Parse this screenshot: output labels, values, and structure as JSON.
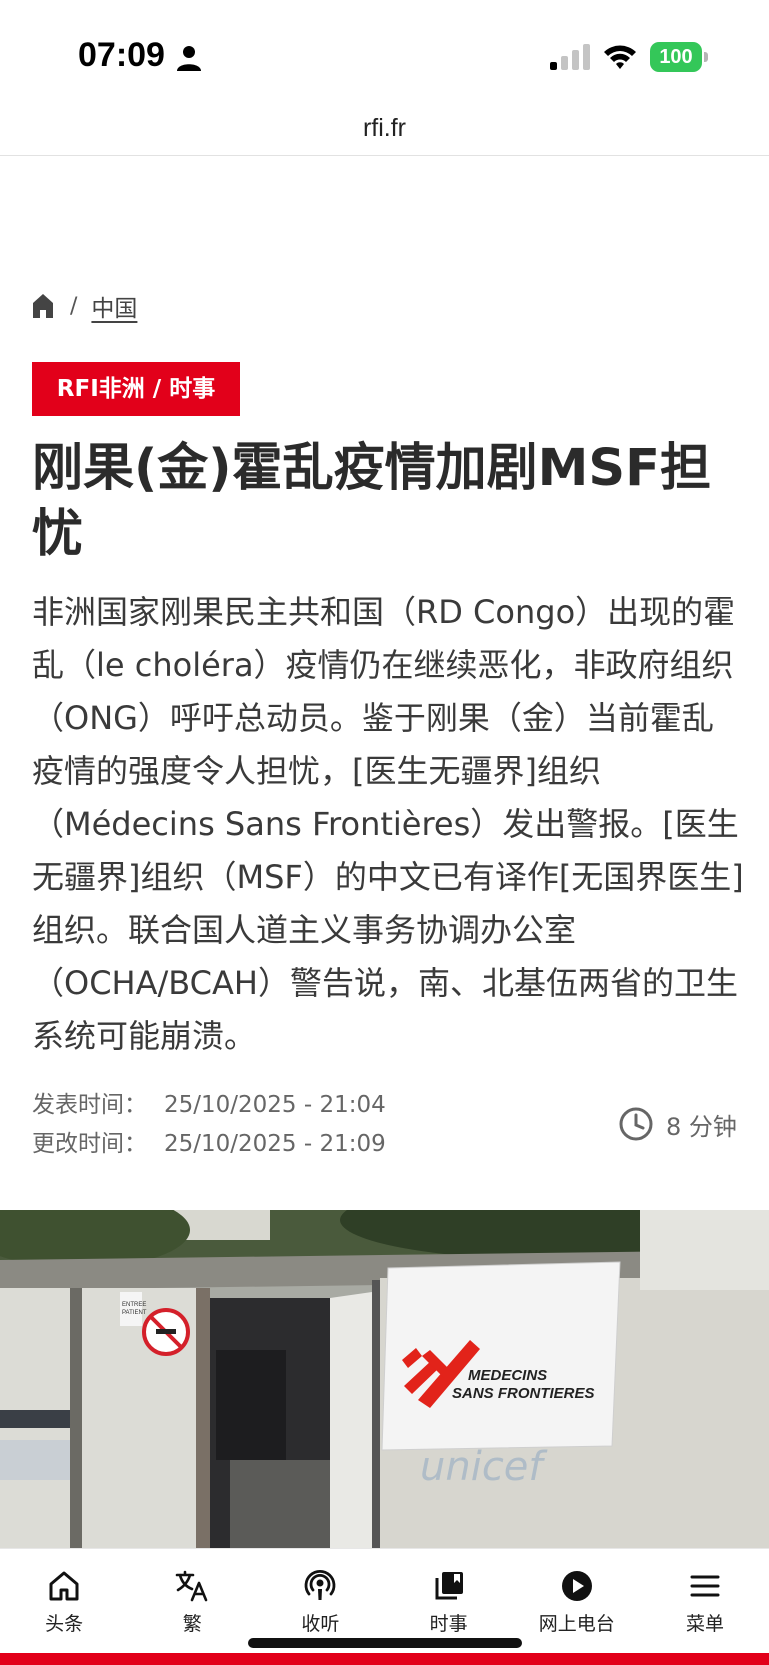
{
  "status_bar": {
    "time": "07:09",
    "battery": "100"
  },
  "browser": {
    "url": "rfi.fr"
  },
  "breadcrumb": {
    "separator": "/",
    "section": "中国"
  },
  "article": {
    "badge": "RFI非洲 / 时事",
    "headline": "刚果(金)霍乱疫情加剧MSF担忧",
    "lede": "非洲国家刚果民主共和国（RD Congo）出现的霍乱（le choléra）疫情仍在继续恶化，非政府组织（ONG）呼吁总动员。鉴于刚果（金）当前霍乱疫情的强度令人担忧，[医生无疆界]组织（Médecins Sans Frontières）发出警报。[医生无疆界]组织（MSF）的中文已有译作[无国界医生]组织。联合国人道主义事务协调办公室（OCHA/BCAH）警告说，南、北基伍两省的卫生系统可能崩溃。",
    "published_label": "发表时间：",
    "published_value": "25/10/2025 - 21:04",
    "modified_label": "更改时间：",
    "modified_value": "25/10/2025 - 21:09",
    "read_time": "8 分钟"
  },
  "hero_image": {
    "flag_text_line1": "MEDECINS",
    "flag_text_line2": "SANS FRONTIERES",
    "sign_text_line1": "ENTREE",
    "sign_text_line2": "PATIENT"
  },
  "tabbar": {
    "items": [
      {
        "label": "头条",
        "icon": "home-icon"
      },
      {
        "label": "繁",
        "icon": "translate-icon"
      },
      {
        "label": "收听",
        "icon": "podcast-icon"
      },
      {
        "label": "时事",
        "icon": "news-stack-icon"
      },
      {
        "label": "网上电台",
        "icon": "play-icon"
      },
      {
        "label": "菜单",
        "icon": "menu-icon"
      }
    ]
  },
  "colors": {
    "brand_red": "#e2001a",
    "battery_green": "#34c759"
  }
}
